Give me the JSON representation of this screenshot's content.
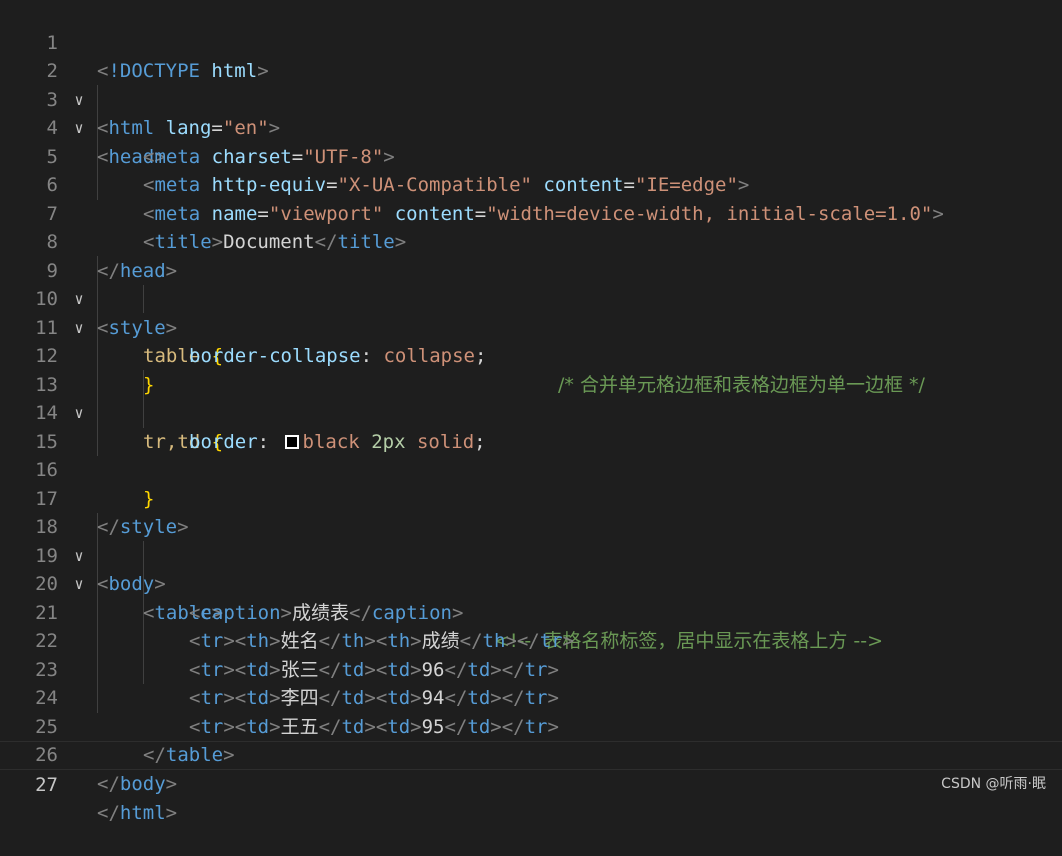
{
  "editor": {
    "line_numbers": [
      "1",
      "2",
      "3",
      "4",
      "5",
      "6",
      "7",
      "8",
      "9",
      "10",
      "11",
      "12",
      "13",
      "14",
      "15",
      "16",
      "17",
      "18",
      "19",
      "20",
      "21",
      "22",
      "23",
      "24",
      "25",
      "26",
      "27"
    ],
    "lines": {
      "l1": {
        "lt": "<",
        "kw": "!DOCTYPE",
        "sp": " ",
        "attr": "html",
        "gt": ">"
      },
      "l2": {
        "lt": "<",
        "tag": "html",
        "attr": " lang",
        "eq": "=",
        "str": "\"en\"",
        "gt": ">"
      },
      "l3": {
        "lt": "<",
        "tag": "head",
        "gt": ">"
      },
      "l4": {
        "lt": "<",
        "tag": "meta",
        "attr": " charset",
        "eq": "=",
        "str": "\"UTF-8\"",
        "gt": ">"
      },
      "l5": {
        "lt": "<",
        "tag": "meta",
        "attr1": " http-equiv",
        "eq1": "=",
        "str1": "\"X-UA-Compatible\"",
        "attr2": " content",
        "eq2": "=",
        "str2": "\"IE=edge\"",
        "gt": ">"
      },
      "l6": {
        "lt": "<",
        "tag": "meta",
        "attr1": " name",
        "eq1": "=",
        "str1": "\"viewport\"",
        "attr2": " content",
        "eq2": "=",
        "str2": "\"width=device-width, initial-scale=1.0\"",
        "gt": ">"
      },
      "l7": {
        "lt": "<",
        "tag": "title",
        "gt": ">",
        "text": "Document",
        "lt2": "</",
        "tag2": "title",
        "gt2": ">"
      },
      "l8": {
        "lt": "</",
        "tag": "head",
        "gt": ">"
      },
      "l9": {
        "lt": "<",
        "tag": "style",
        "gt": ">"
      },
      "l10": {
        "sel": "table",
        "brace": " {"
      },
      "l11": {
        "prop": "border-collapse",
        "colon": ":",
        "val": " collapse",
        "semi": ";",
        "cmt": "/* 合并单元格边框和表格边框为单一边框 */"
      },
      "l12": {
        "brace": "}"
      },
      "l13": {
        "sel": "tr,td",
        "brace": " {"
      },
      "l14": {
        "prop": "border",
        "colon": ":",
        "val": "black",
        "num": " 2px",
        "val2": " solid",
        "semi": ";"
      },
      "l16": {
        "brace": "}"
      },
      "l17": {
        "lt": "</",
        "tag": "style",
        "gt": ">"
      },
      "l18": {
        "lt": "<",
        "tag": "body",
        "gt": ">"
      },
      "l19": {
        "lt": "<",
        "tag": "table",
        "gt": ">"
      },
      "l20": {
        "lt": "<",
        "tag": "caption",
        "gt": ">",
        "text": "成绩表",
        "lt2": "</",
        "tag2": "caption",
        "gt2": ">",
        "cmt": "<!--  表格名称标签，居中显示在表格上方 -->"
      },
      "l21": {
        "a": "<",
        "b": "tr",
        "c": "><",
        "d": "th",
        "e": ">",
        "f": "姓名",
        "g": "</",
        "h": "th",
        "i": "><",
        "j": "th",
        "k": ">",
        "l": "成绩",
        "m": "</",
        "n": "th",
        "o": "></",
        "p": "tr",
        "q": ">"
      },
      "l22": {
        "a": "<",
        "b": "tr",
        "c": "><",
        "d": "td",
        "e": ">",
        "f": "张三",
        "g": "</",
        "h": "td",
        "i": "><",
        "j": "td",
        "k": ">",
        "l": "96",
        "m": "</",
        "n": "td",
        "o": "></",
        "p": "tr",
        "q": ">"
      },
      "l23": {
        "a": "<",
        "b": "tr",
        "c": "><",
        "d": "td",
        "e": ">",
        "f": "李四",
        "g": "</",
        "h": "td",
        "i": "><",
        "j": "td",
        "k": ">",
        "l": "94",
        "m": "</",
        "n": "td",
        "o": "></",
        "p": "tr",
        "q": ">"
      },
      "l24": {
        "a": "<",
        "b": "tr",
        "c": "><",
        "d": "td",
        "e": ">",
        "f": "王五",
        "g": "</",
        "h": "td",
        "i": "><",
        "j": "td",
        "k": ">",
        "l": "95",
        "m": "</",
        "n": "td",
        "o": "></",
        "p": "tr",
        "q": ">"
      },
      "l25": {
        "lt": "</",
        "tag": "table",
        "gt": ">"
      },
      "l26": {
        "lt": "</",
        "tag": "body",
        "gt": ">"
      },
      "l27": {
        "lt": "</",
        "tag": "html",
        "gt": ">"
      }
    },
    "fold_icon": "chevron-down-icon",
    "fold_glyph": "∨",
    "swatch_color": "#000000"
  },
  "watermark": "CSDN @听雨·眠"
}
